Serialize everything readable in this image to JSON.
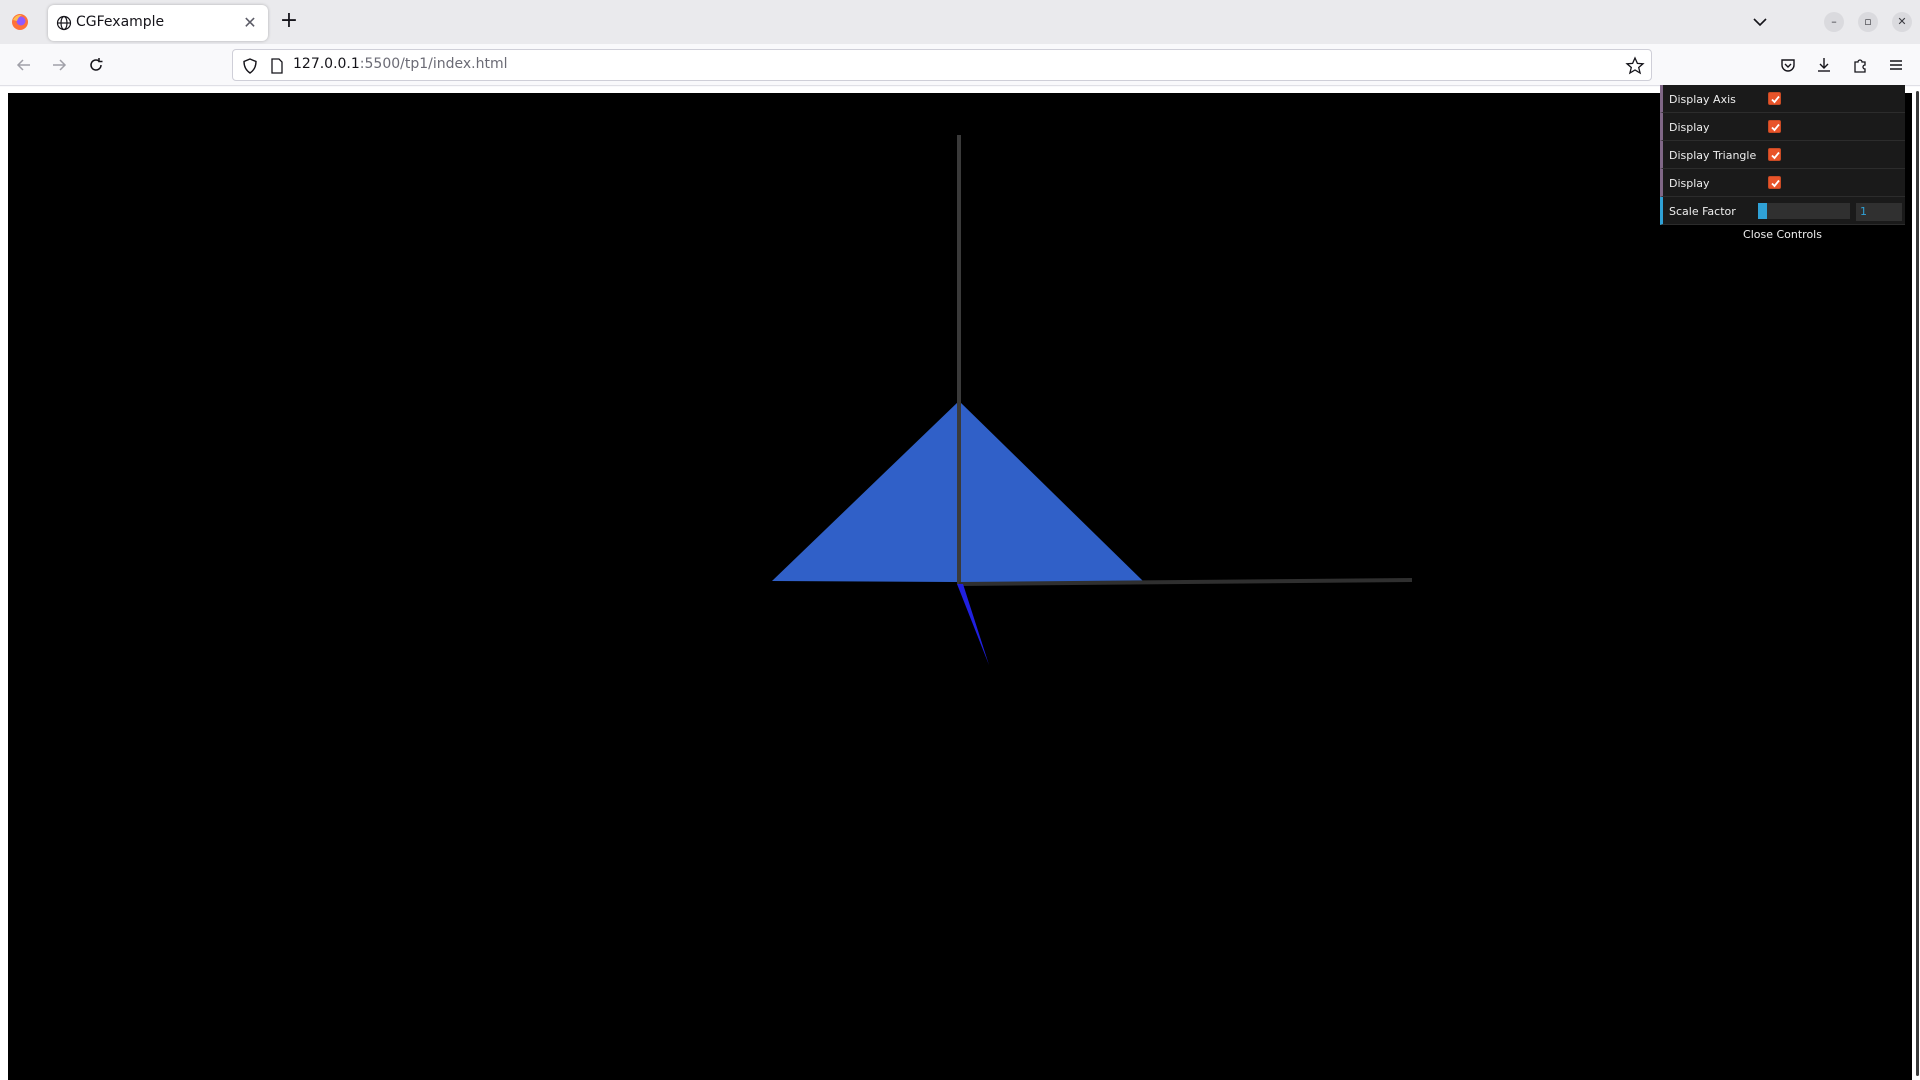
{
  "browser": {
    "tab": {
      "title": "CGFexample"
    },
    "url": {
      "host": "127.0.0.1",
      "path": ":5500/tp1/index.html"
    }
  },
  "scene": {
    "background_color": "#000000",
    "triangle_color": "#3060c8",
    "axis_color": "#3a3a3a",
    "z_axis_color": "#2020e0"
  },
  "gui": {
    "controls": [
      {
        "label": "Display Axis",
        "checked": true
      },
      {
        "label": "Display",
        "checked": true
      },
      {
        "label": "Display Triangle",
        "checked": true
      },
      {
        "label": "Display",
        "checked": true
      }
    ],
    "scale_factor": {
      "label": "Scale Factor",
      "value": "1",
      "fraction": 0.1
    },
    "close_label": "Close Controls",
    "accent_checkbox_color": "#e8542a",
    "accent_number_color": "#2fa1d6"
  }
}
